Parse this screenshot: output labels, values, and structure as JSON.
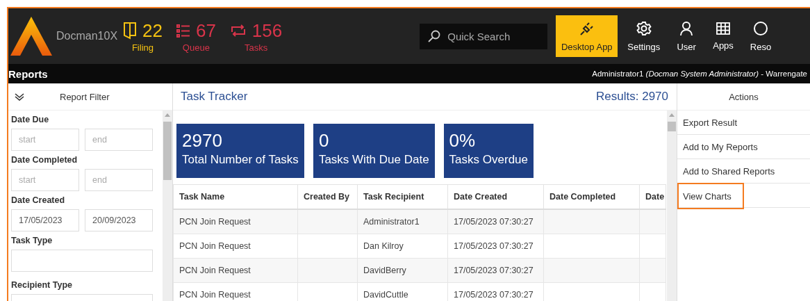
{
  "header": {
    "app_name": "Docman10X",
    "counters": [
      {
        "kind": "filing",
        "value": "22",
        "label": "Filing"
      },
      {
        "kind": "queue",
        "value": "67",
        "label": "Queue"
      },
      {
        "kind": "tasks",
        "value": "156",
        "label": "Tasks"
      }
    ],
    "search": {
      "placeholder": "Quick Search"
    },
    "nav": [
      {
        "kind": "plug",
        "label": "Desktop App",
        "selected": true
      },
      {
        "kind": "gear",
        "label": "Settings",
        "selected": false
      },
      {
        "kind": "user",
        "label": "User",
        "selected": false
      },
      {
        "kind": "grid",
        "label": "Apps",
        "selected": false
      },
      {
        "kind": "circle",
        "label": "Reso",
        "selected": false
      }
    ]
  },
  "title_bar": {
    "title": "Reports",
    "user": "Administrator1 *(Docman System Administrator)* - Warrengate"
  },
  "filter": {
    "title": "Report Filter",
    "fields": [
      {
        "label": "Date Due",
        "kind": "range",
        "inputs": [
          {
            "placeholder": "start"
          },
          {
            "placeholder": "end"
          }
        ]
      },
      {
        "label": "Date Completed",
        "kind": "range",
        "inputs": [
          {
            "placeholder": "start"
          },
          {
            "placeholder": "end"
          }
        ]
      },
      {
        "label": "Date Created",
        "kind": "range",
        "inputs": [
          {
            "value": "17/05/2023"
          },
          {
            "value": "20/09/2023"
          }
        ]
      },
      {
        "label": "Task Type",
        "kind": "text"
      },
      {
        "label": "Recipient Type",
        "kind": "text"
      }
    ]
  },
  "report": {
    "title": "Task Tracker",
    "results": "Results: 2970",
    "metrics": [
      {
        "value": "2970",
        "label": "Total Number of Tasks"
      },
      {
        "value": "0",
        "label": "Tasks With Due Date"
      },
      {
        "value": "0%",
        "label": "Tasks Overdue"
      }
    ],
    "table": {
      "columns": [
        "Task Name",
        "Created By",
        "Task Recipient",
        "Date Created",
        "Date Completed",
        "Date"
      ],
      "rows": [
        {
          "cells": [
            "PCN Join Request",
            null,
            "Administrator1",
            "17/05/2023 07:30:27",
            null,
            null
          ]
        },
        {
          "cells": [
            "PCN Join Request",
            null,
            "Dan Kilroy",
            "17/05/2023 07:30:27",
            null,
            null
          ]
        },
        {
          "cells": [
            "PCN Join Request",
            null,
            "DavidBerry",
            "17/05/2023 07:30:27",
            null,
            null
          ]
        },
        {
          "cells": [
            "PCN Join Request",
            null,
            "DavidCuttle",
            "17/05/2023 07:30:27",
            null,
            null
          ]
        }
      ]
    }
  },
  "actions": {
    "title": "Actions",
    "items": [
      {
        "label": "Export Result",
        "highlighted": false
      },
      {
        "label": "Add to My Reports",
        "highlighted": false
      },
      {
        "label": "Add to Shared Reports",
        "highlighted": false
      },
      {
        "label": "View Charts",
        "highlighted": true
      }
    ]
  }
}
